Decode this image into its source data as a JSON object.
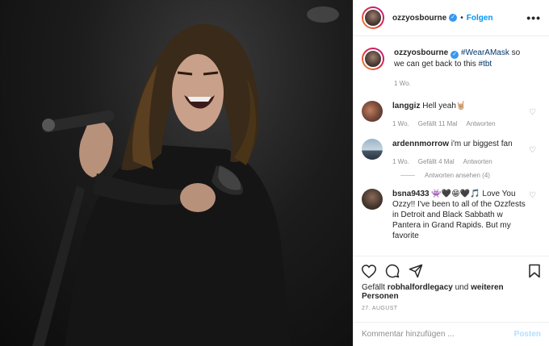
{
  "header": {
    "username": "ozzyosbourne",
    "separator": "•",
    "follow_label": "Folgen",
    "more_label": "•••"
  },
  "caption": {
    "username": "ozzyosbourne",
    "hashtag1": "#WearAMask",
    "text_mid": " so we can get back to this ",
    "hashtag2": "#tbt",
    "age": "1 Wo."
  },
  "comments": [
    {
      "username": "langgiz",
      "text": "Hell yeah🤘🏼",
      "age": "1 Wo.",
      "likes": "Gefällt 11 Mal",
      "reply": "Antworten"
    },
    {
      "username": "ardennmorrow",
      "text": "i'm ur biggest fan",
      "age": "1 Wo.",
      "likes": "Gefällt 4 Mal",
      "reply": "Antworten",
      "view_replies": "Antworten ansehen (4)"
    },
    {
      "username": "bsna9433",
      "text": "👾🖤😁🖤🎵 Love You Ozzy!! I've been to all of the Ozzfests in Detroit and Black Sabbath w Pantera in Grand Rapids. But my favorite"
    }
  ],
  "likes": {
    "prefix": "Gefällt",
    "user": "robhalfordlegacy",
    "mid": "und",
    "others": "weiteren Personen"
  },
  "post_date": "27. AUGUST",
  "composer": {
    "placeholder": "Kommentar hinzufügen ...",
    "post_label": "Posten"
  },
  "icons": [
    "verified-icon",
    "more-icon",
    "heart-icon",
    "comment-icon",
    "share-icon",
    "bookmark-icon"
  ],
  "colors": {
    "link": "#0095f6",
    "verified": "#3897f0",
    "muted": "#8e8e8e",
    "post_disabled": "#b2dffc"
  }
}
